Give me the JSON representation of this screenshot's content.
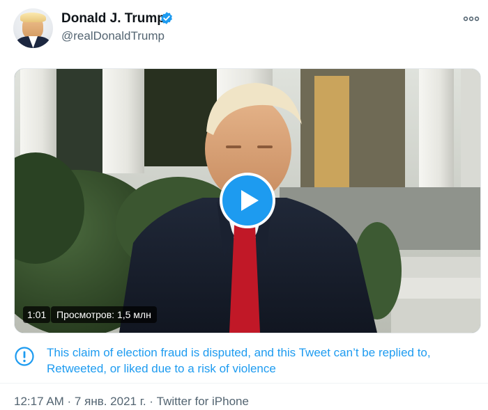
{
  "tweet": {
    "display_name": "Donald J. Trump",
    "handle": "@realDonaldTrump",
    "verified": true,
    "avatar_icon": "profile-photo",
    "more_icon": "more-options-icon"
  },
  "media": {
    "type": "video",
    "duration": "1:01",
    "views": "Просмотров: 1,5 млн",
    "play_icon": "play-icon"
  },
  "notice": {
    "icon": "info-exclamation-icon",
    "text": "This claim of election fraud is disputed, and this Tweet can’t be replied to, Retweeted, or liked due to a risk of violence"
  },
  "meta": {
    "time": "12:17 AM",
    "date": "7 янв. 2021 г.",
    "source": "Twitter for iPhone",
    "text": "12:17 AM · 7 янв. 2021 г. · Twitter for iPhone"
  },
  "colors": {
    "accent": "#1d9bf0",
    "text_primary": "#0f1419",
    "text_secondary": "#536471"
  }
}
